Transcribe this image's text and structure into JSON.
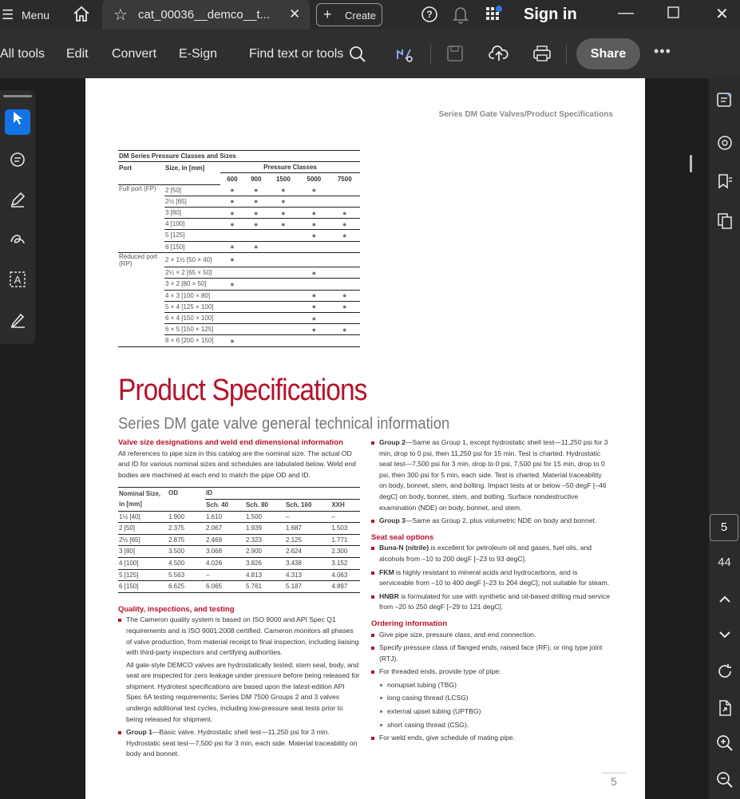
{
  "window": {
    "menu_label": "Menu",
    "tab_title": "cat_00036__demco__t...",
    "create_label": "Create",
    "sign_in": "Sign in"
  },
  "toolbar": {
    "all_tools": "All tools",
    "edit": "Edit",
    "convert": "Convert",
    "esign": "E-Sign",
    "find": "Find text or tools",
    "share": "Share"
  },
  "right_rail": {
    "page_current": "5",
    "page_total": "44"
  },
  "page": {
    "header": "Series DM Gate Valves/Product Specifications",
    "pressure_table": {
      "title": "DM Series Pressure Classes and Sizes",
      "col_port": "Port",
      "col_size": "Size, in [mm]",
      "col_group": "Pressure Classes",
      "classes": [
        "600",
        "900",
        "1500",
        "5000",
        "7500"
      ],
      "rows": [
        {
          "port": "Full port (FP)",
          "size": "2 [50]",
          "dots": [
            1,
            1,
            1,
            1,
            0
          ]
        },
        {
          "port": "",
          "size": "2½ [65]",
          "dots": [
            1,
            1,
            1,
            0,
            0
          ]
        },
        {
          "port": "",
          "size": "3 [80]",
          "dots": [
            1,
            1,
            1,
            1,
            1
          ]
        },
        {
          "port": "",
          "size": "4 [100]",
          "dots": [
            1,
            1,
            1,
            1,
            1
          ]
        },
        {
          "port": "",
          "size": "5 [125]",
          "dots": [
            0,
            0,
            0,
            1,
            1
          ]
        },
        {
          "port": "",
          "size": "6 [150]",
          "dots": [
            1,
            1,
            0,
            0,
            0
          ]
        },
        {
          "port": "Reduced port (RP)",
          "size": "2 × 1½ [50 × 40]",
          "dots": [
            1,
            0,
            0,
            0,
            0
          ]
        },
        {
          "port": "",
          "size": "2½ × 2 [65 × 50]",
          "dots": [
            0,
            0,
            0,
            1,
            0
          ]
        },
        {
          "port": "",
          "size": "3 × 2 [80 × 50]",
          "dots": [
            1,
            0,
            0,
            0,
            0
          ]
        },
        {
          "port": "",
          "size": "4 × 3 [100 × 80]",
          "dots": [
            0,
            0,
            0,
            1,
            1
          ]
        },
        {
          "port": "",
          "size": "5 × 4 [125 × 100]",
          "dots": [
            0,
            0,
            0,
            1,
            1
          ]
        },
        {
          "port": "",
          "size": "6 × 4 [150 × 100]",
          "dots": [
            0,
            0,
            0,
            1,
            0
          ]
        },
        {
          "port": "",
          "size": "6 × 5 [150 × 125]",
          "dots": [
            0,
            0,
            0,
            1,
            1
          ]
        },
        {
          "port": "",
          "size": "8 × 6 [200 × 150]",
          "dots": [
            1,
            0,
            0,
            0,
            0
          ]
        }
      ]
    },
    "title": "Product Specifications",
    "subtitle": "Series DM gate valve general technical information",
    "valve_size": {
      "heading": "Valve size designations and weld end dimensional information",
      "text": "All references to pipe size in this catalog are the nominal size. The actual OD and ID for various nominal sizes and schedules are tabulated below. Weld end bodies are machined at each end to match the pipe OD and ID."
    },
    "nominal_table": {
      "h_nominal": "Nominal Size, in [mm]",
      "h_od": "OD",
      "h_id": "ID",
      "schedules": [
        "Sch. 40",
        "Sch. 80",
        "Sch. 160",
        "XXH"
      ],
      "rows": [
        [
          "1½ [40]",
          "1.900",
          "1.610",
          "1.500",
          "–",
          "–"
        ],
        [
          "2 [50]",
          "2.375",
          "2.067",
          "1.939",
          "1.687",
          "1.503"
        ],
        [
          "2½ [65]",
          "2.875",
          "2.469",
          "2.323",
          "2.125",
          "1.771"
        ],
        [
          "3 [80]",
          "3.500",
          "3.068",
          "2.900",
          "2.624",
          "2.300"
        ],
        [
          "4 [100]",
          "4.500",
          "4.026",
          "3.826",
          "3.438",
          "3.152"
        ],
        [
          "5 [125]",
          "5.563",
          "–",
          "4.813",
          "4.313",
          "4.063"
        ],
        [
          "6 [150]",
          "6.625",
          "6.065",
          "5.761",
          "5.187",
          "4.897"
        ]
      ]
    },
    "quality": {
      "heading": "Quality, inspections, and testing",
      "p1": "The Cameron quality system is based on ISO 9000 and API Spec Q1 requirements and is ISO 9001:2008 certified. Cameron monitors all phases of valve production, from material receipt to final inspection, including liaising with third-party inspectors and certifying authorities.",
      "p2": "All gate-style DEMCO valves are hydrostatically tested; stem seal, body, and seat are inspected for zero leakage under pressure before being released for shipment. Hydrotest specifications are based upon the latest-edition API Spec 6A testing requirements; Series DM 7500 Groups 2 and 3 valves undergo additional test cycles, including low-pressure seat tests prior to being released for shipment.",
      "g1_label": "Group 1",
      "g1_text": "—Basic valve. Hydrostatic shell test—11,250 psi for 3 min. Hydrostatic seat test—7,500 psi for 3 min, each side. Material traceability on body and bonnet."
    },
    "right": {
      "g2_label": "Group 2",
      "g2_text": "—Same as Group 1, except hydrostatic shell test—11,250 psi for 3 min, drop to 0 psi, then 11,250 psi for 15 min. Test is charted. Hydrostatic seat test—7,500 psi for 3 min, drop to 0 psi, 7,500 psi for 15 min, drop to 0 psi, then 300 psi for 5 min, each side. Test is charted. Material traceability on body, bonnet, stem, and bolting. Impact tests at or below –50 degF [–46 degC] on body, bonnet, stem, and bolting. Surface nondestructive examination (NDE) on body, bonnet, and stem.",
      "g3_label": "Group 3",
      "g3_text": "—Same as Group 2, plus volumetric NDE on body and bonnet.",
      "seat_heading": "Seat seal options",
      "buna_label": "Buna-N (nitrile)",
      "buna_text": " is excellent for petroleum oil and gases, fuel oils, and alcohols from –10 to 200 degF [–23 to 93 degC].",
      "fkm_label": "FKM",
      "fkm_text": " is highly resistant to mineral acids and hydrocarbons, and is serviceable from –10 to 400 degF [–23 to 204 degC]; not suitable for steam.",
      "hnbr_label": "HNBR",
      "hnbr_text": " is formulated for use with synthetic and oil-based drilling mud service from –20 to 250 degF [–29 to 121 degC].",
      "order_heading": "Ordering information",
      "o1": "Give pipe size, pressure class, and end connection.",
      "o2": "Specify pressure class of flanged ends, raised face (RF), or ring type joint (RTJ).",
      "o3": "For threaded ends, provide type of pipe:",
      "subs": [
        "nonupset tubing (TBG)",
        "long casing thread (LCSG)",
        "external upset tubing (UPTBG)",
        "short casing thread (CSG)."
      ],
      "o4": "For weld ends, give schedule of mating pipe."
    },
    "page_number": "5"
  }
}
